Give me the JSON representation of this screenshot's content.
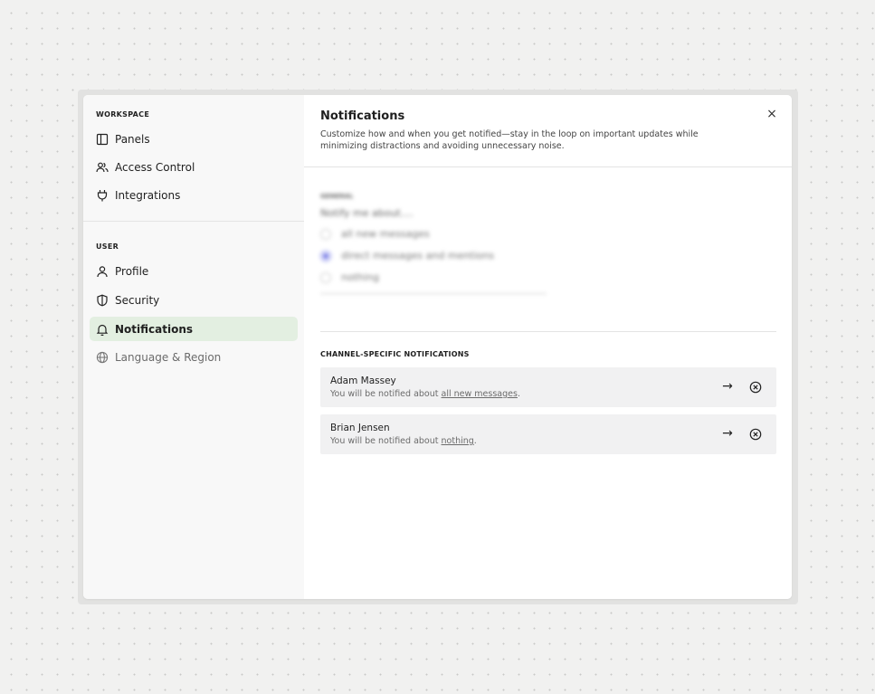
{
  "sidebar": {
    "workspace_label": "WORKSPACE",
    "user_label": "USER",
    "workspace_items": [
      {
        "label": "Panels",
        "icon": "panels-icon"
      },
      {
        "label": "Access Control",
        "icon": "users-icon"
      },
      {
        "label": "Integrations",
        "icon": "plug-icon"
      }
    ],
    "user_items": [
      {
        "label": "Profile",
        "icon": "person-icon"
      },
      {
        "label": "Security",
        "icon": "shield-icon"
      },
      {
        "label": "Notifications",
        "icon": "bell-icon",
        "active": true
      },
      {
        "label": "Language & Region",
        "icon": "globe-icon",
        "muted": true
      }
    ]
  },
  "header": {
    "title": "Notifications",
    "description": "Customize how and when you get notified—stay in the loop on important updates while minimizing distractions and avoiding unnecessary noise.",
    "close_label": "×"
  },
  "general": {
    "label": "GENERAL",
    "question": "Notify me about....",
    "options": [
      {
        "label": "all new messages",
        "selected": false
      },
      {
        "label": "direct messages and mentions",
        "selected": true
      },
      {
        "label": "nothing",
        "selected": false
      }
    ]
  },
  "channels": {
    "label": "CHANNEL-SPECIFIC NOTIFICATIONS",
    "items": [
      {
        "name": "Adam Massey",
        "prefix": "You will be notified about ",
        "setting": "all new messages",
        "suffix": "."
      },
      {
        "name": "Brian Jensen",
        "prefix": "You will be notified about ",
        "setting": "nothing",
        "suffix": "."
      }
    ],
    "arrow_label": "→"
  },
  "colors": {
    "active_bg": "#e3efe1",
    "radio_selected": "#5a60e0",
    "card_bg": "#f1f1f2"
  }
}
